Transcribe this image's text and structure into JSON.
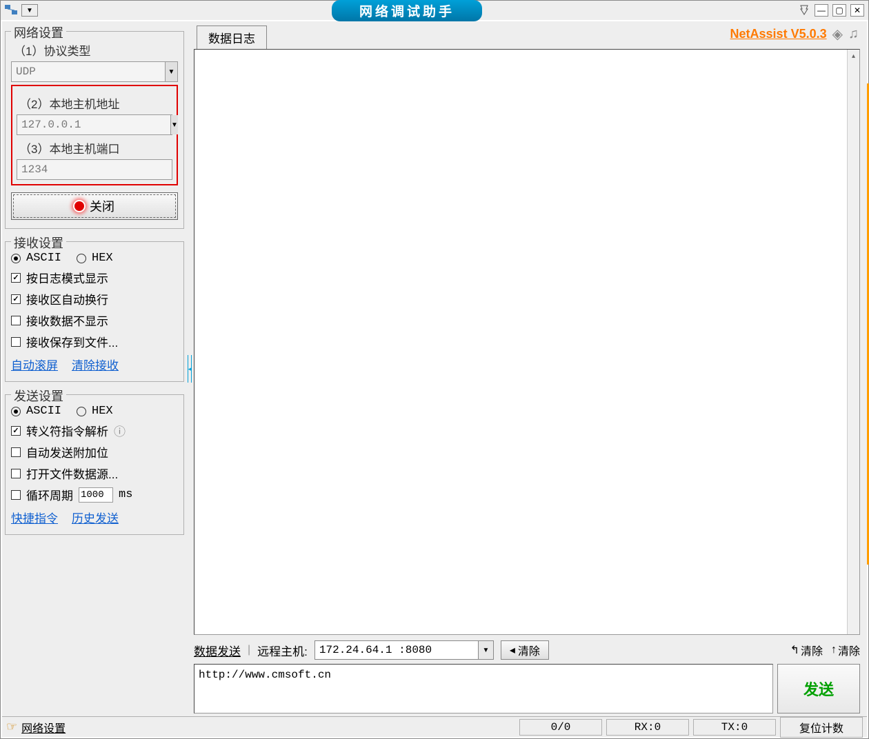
{
  "title": "网络调试助手",
  "brand": "NetAssist V5.0.3",
  "sidebar": {
    "network": {
      "title": "网络设置",
      "proto_label": "（1）协议类型",
      "proto_value": "UDP",
      "host_label": "（2）本地主机地址",
      "host_value": "127.0.0.1",
      "port_label": "（3）本地主机端口",
      "port_value": "1234",
      "toggle_label": "关闭"
    },
    "recv": {
      "title": "接收设置",
      "ascii": "ASCII",
      "hex": "HEX",
      "log_mode": "按日志模式显示",
      "auto_wrap": "接收区自动换行",
      "no_display": "接收数据不显示",
      "save_file": "接收保存到文件...",
      "auto_scroll": "自动滚屏",
      "clear_recv": "清除接收"
    },
    "send": {
      "title": "发送设置",
      "ascii": "ASCII",
      "hex": "HEX",
      "escape": "转义符指令解析",
      "auto_extra": "自动发送附加位",
      "open_file": "打开文件数据源...",
      "loop_label": "循环周期",
      "loop_value": "1000",
      "loop_unit": "ms",
      "shortcut": "快捷指令",
      "history": "历史发送"
    }
  },
  "main": {
    "log_tab": "数据日志",
    "send_label": "数据发送",
    "remote_label": "远程主机:",
    "remote_value": "172.24.64.1 :8080",
    "clear_btn": "清除",
    "clear_link1": "清除",
    "clear_link2": "清除",
    "send_text": "http://www.cmsoft.cn",
    "send_btn": "发送"
  },
  "status": {
    "settings": "网络设置",
    "counter": "0/0",
    "rx": "RX:0",
    "tx": "TX:0",
    "reset": "复位计数"
  }
}
